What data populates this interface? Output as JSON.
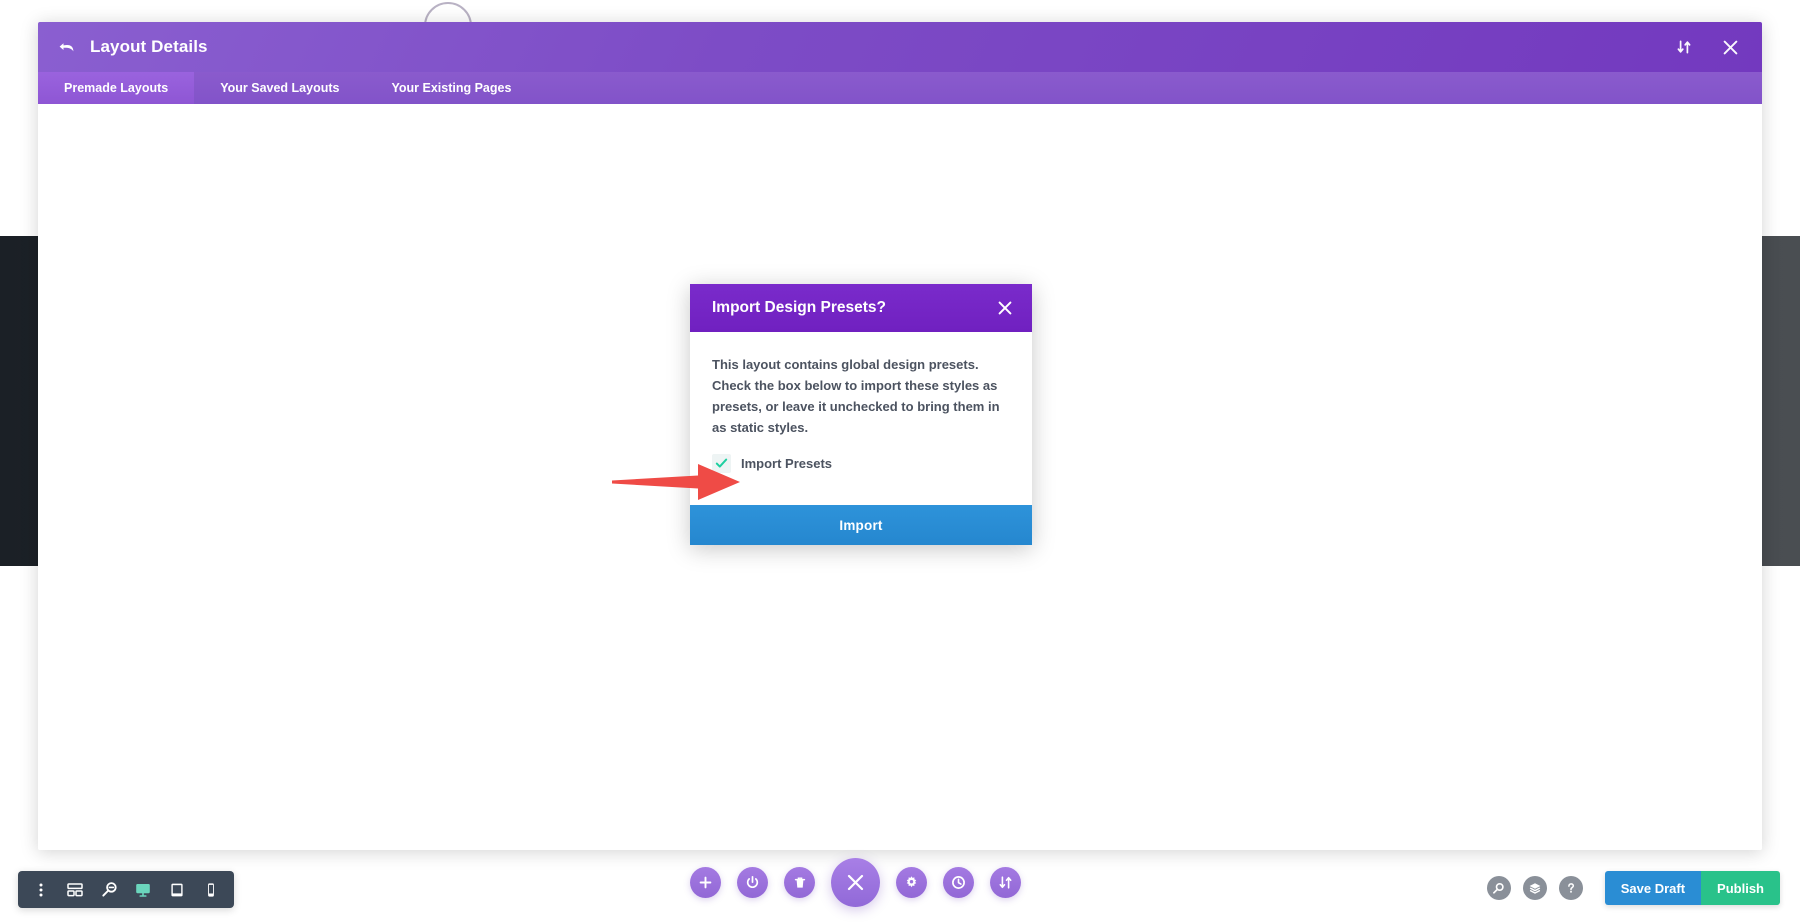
{
  "panel": {
    "title": "Layout Details",
    "back_icon": "back-arrow-icon",
    "sort_icon": "sort-updown-icon",
    "close_icon": "close-icon",
    "tabs": [
      {
        "label": "Premade Layouts",
        "active": true
      },
      {
        "label": "Your Saved Layouts",
        "active": false
      },
      {
        "label": "Your Existing Pages",
        "active": false
      }
    ]
  },
  "modal": {
    "title": "Import Design Presets?",
    "close_icon": "close-icon",
    "body_text": "This layout contains global design presets. Check the box below to import these styles as presets, or leave it unchecked to bring them in as static styles.",
    "checkbox": {
      "label": "Import Presets",
      "checked": true,
      "check_icon": "checkmark-icon",
      "check_color": "#1ecfa0"
    },
    "import_button": "Import"
  },
  "annotation": {
    "arrow_color": "#ef4b46",
    "points_to": "import-presets-checkbox"
  },
  "bottom_left_toolbar": {
    "items": [
      {
        "icon": "kebab-menu-icon",
        "active": false
      },
      {
        "icon": "wireframe-grid-icon",
        "active": false
      },
      {
        "icon": "zoom-out-icon",
        "active": false
      },
      {
        "icon": "desktop-view-icon",
        "active": true
      },
      {
        "icon": "tablet-view-icon",
        "active": false
      },
      {
        "icon": "phone-view-icon",
        "active": false
      }
    ]
  },
  "center_toolbar": {
    "items": [
      {
        "icon": "plus-icon",
        "size": "small"
      },
      {
        "icon": "power-icon",
        "size": "small"
      },
      {
        "icon": "trash-icon",
        "size": "small"
      },
      {
        "icon": "close-x-icon",
        "size": "large"
      },
      {
        "icon": "gear-icon",
        "size": "small"
      },
      {
        "icon": "history-clock-icon",
        "size": "small"
      },
      {
        "icon": "sort-updown-icon",
        "size": "small"
      }
    ]
  },
  "bottom_right_toolbar": {
    "icons": [
      {
        "icon": "search-icon"
      },
      {
        "icon": "layers-icon"
      },
      {
        "icon": "help-question-icon"
      }
    ],
    "save_draft_label": "Save Draft",
    "publish_label": "Publish",
    "save_draft_color": "#2a8dd4",
    "publish_color": "#29c28a"
  },
  "colors": {
    "panel_header_purple": "#7d4cc6",
    "panel_tabs_purple": "#8253c9",
    "active_tab_purple": "#9158d8",
    "modal_header_purple": "#7020c0",
    "import_blue": "#2a8dd4",
    "toolbar_dark": "#3c4857",
    "circle_purple": "#9c72dd"
  }
}
